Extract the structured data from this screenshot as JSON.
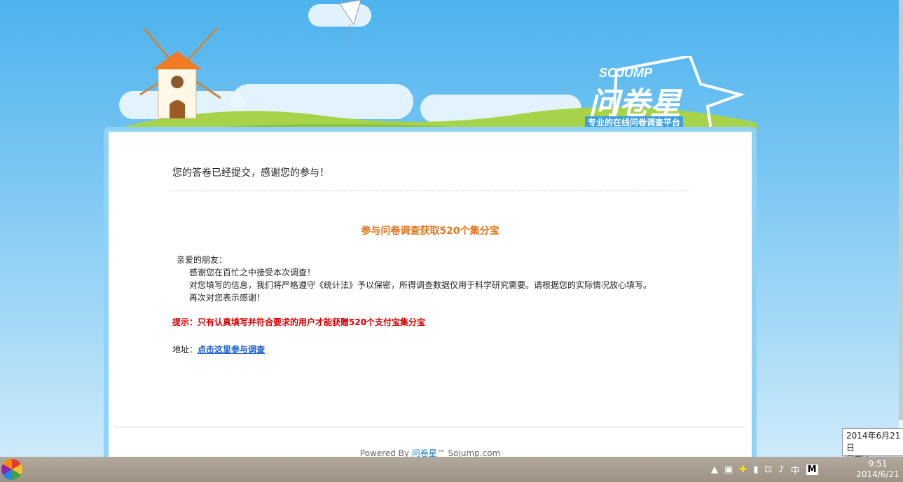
{
  "header": {
    "logo_en": "SOJUMP",
    "logo_cn": "问卷星",
    "slogan": "专业的在线问卷调查平台"
  },
  "main": {
    "thanks": "您的答卷已经提交，感谢您的参与！",
    "promo_title": "参与问卷调查获取520个集分宝",
    "letter": {
      "greeting": "亲爱的朋友：",
      "line1": "感谢您在百忙之中接受本次调查！",
      "line2": "对您填写的信息，我们将严格遵守《统计法》予以保密，所得调查数据仅用于科学研究需要。请根据您的实际情况放心填写。",
      "line3": "再次对您表示感谢！"
    },
    "hint": "提示：只有认真填写并符合要求的用户才能获赠520个支付宝集分宝",
    "address_label": "地址：",
    "address_link": "点击这里参与调查"
  },
  "footer": {
    "prefix": "Powered By ",
    "brand": "问卷星",
    "suffix": "™ Sojump.com"
  },
  "tooltip": {
    "date": "2014年6月21日",
    "weekday": "星期六"
  },
  "taskbar": {
    "ime": "中",
    "ime_mode": "M",
    "time": "9:51",
    "date": "2014/6/21"
  },
  "colors": {
    "card_border": "#8fd2f7",
    "promo_orange": "#e0751b",
    "hint_red": "#d40000",
    "link_blue": "#1a5dd1"
  }
}
